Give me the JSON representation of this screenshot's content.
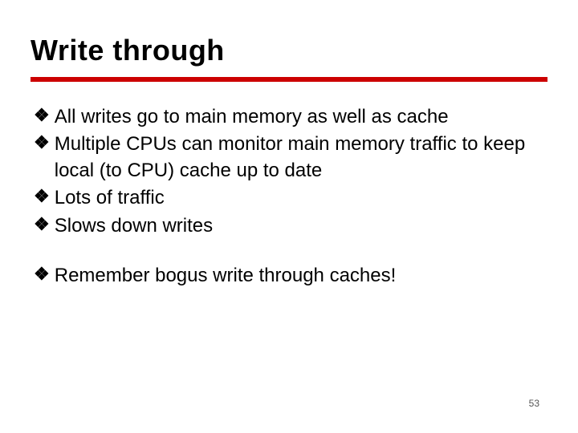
{
  "slide": {
    "title": "Write through",
    "bullets_group1": [
      {
        "text": "All writes go to main memory as well as cache"
      },
      {
        "text": "Multiple CPUs can monitor main memory traffic to keep local (to CPU) cache up to date"
      },
      {
        "text": "Lots of traffic"
      },
      {
        "text": "Slows down writes"
      }
    ],
    "bullets_group2": [
      {
        "text": "Remember bogus write through caches!"
      }
    ],
    "page_number": "53",
    "bullet_glyph": "❖"
  }
}
